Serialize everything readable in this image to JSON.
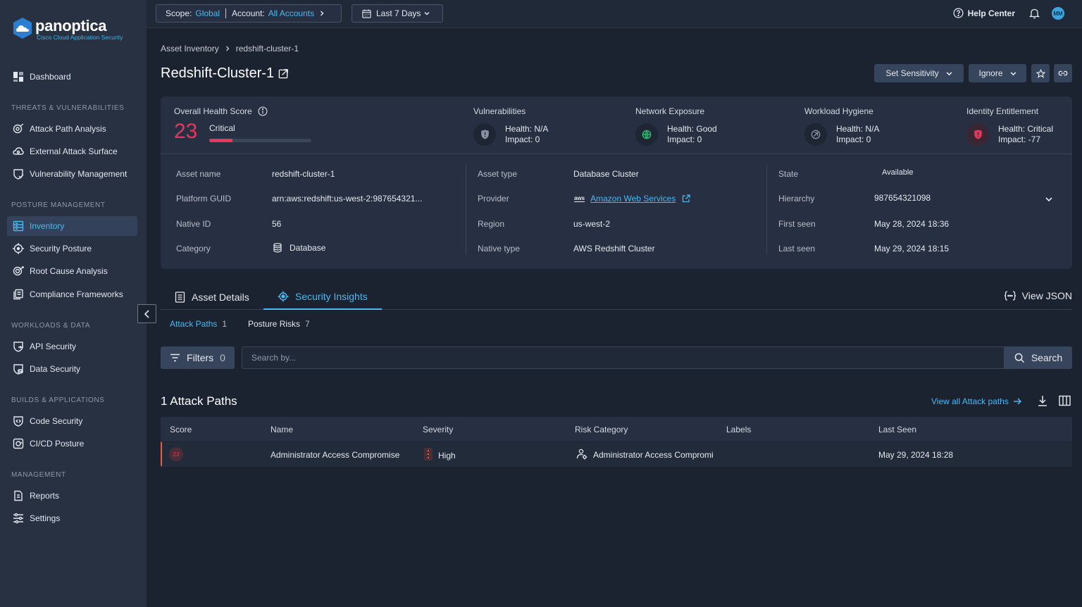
{
  "brand": {
    "name": "panoptica",
    "subtitle": "Cisco Cloud Application Security"
  },
  "colors": {
    "accent": "#4bb8ef",
    "critical": "#e6375f",
    "high": "#e8603a"
  },
  "sidebar": {
    "dashboard": "Dashboard",
    "sections": {
      "threats": "THREATS & VULNERABILITIES",
      "posture": "POSTURE MANAGEMENT",
      "workloads": "WORKLOADS & DATA",
      "builds": "BUILDS & APPLICATIONS",
      "management": "MANAGEMENT"
    },
    "items": {
      "attack_path": "Attack Path Analysis",
      "external": "External Attack Surface",
      "vuln": "Vulnerability Management",
      "inventory": "Inventory",
      "security_posture": "Security Posture",
      "root_cause": "Root Cause Analysis",
      "compliance": "Compliance Frameworks",
      "api": "API Security",
      "data": "Data Security",
      "code": "Code Security",
      "cicd": "CI/CD Posture",
      "reports": "Reports",
      "settings": "Settings"
    }
  },
  "topbar": {
    "scope_label": "Scope:",
    "scope_value": "Global",
    "account_label": "Account:",
    "account_value": "All Accounts",
    "date_range": "Last 7 Days",
    "help": "Help Center",
    "avatar": "MM"
  },
  "breadcrumb": {
    "parent": "Asset Inventory",
    "current": "redshift-cluster-1"
  },
  "page": {
    "title": "Redshift-Cluster-1"
  },
  "actions": {
    "set_sensitivity": "Set Sensitivity",
    "ignore": "Ignore"
  },
  "health": {
    "label": "Overall Health Score",
    "score": "23",
    "status": "Critical",
    "score_fraction": 0.23,
    "metrics": [
      {
        "title": "Vulnerabilities",
        "health": "Health: N/A",
        "impact": "Impact: 0"
      },
      {
        "title": "Network Exposure",
        "health": "Health: Good",
        "impact": "Impact: 0"
      },
      {
        "title": "Workload Hygiene",
        "health": "Health: N/A",
        "impact": "Impact: 0"
      },
      {
        "title": "Identity Entitlement",
        "health": "Health: Critical",
        "impact": "Impact: -77"
      }
    ]
  },
  "details": {
    "asset_name_label": "Asset name",
    "asset_name": "redshift-cluster-1",
    "guid_label": "Platform GUID",
    "guid": "arn:aws:redshift:us-west-2:987654321...",
    "native_id_label": "Native ID",
    "native_id": "56",
    "category_label": "Category",
    "category": "Database",
    "asset_type_label": "Asset type",
    "asset_type": "Database Cluster",
    "provider_label": "Provider",
    "provider": "Amazon Web Services",
    "provider_logo": "aws",
    "region_label": "Region",
    "region": "us-west-2",
    "native_type_label": "Native type",
    "native_type": "AWS Redshift Cluster",
    "state_label": "State",
    "state": "Available",
    "hierarchy_label": "Hierarchy",
    "hierarchy": "987654321098",
    "first_seen_label": "First seen",
    "first_seen": "May 28, 2024 18:36",
    "last_seen_label": "Last seen",
    "last_seen": "May 29, 2024 18:15"
  },
  "tabs": {
    "asset_details": "Asset Details",
    "security_insights": "Security Insights",
    "view_json": "View JSON"
  },
  "subtabs": {
    "attack_paths": "Attack Paths",
    "attack_paths_count": "1",
    "posture_risks": "Posture Risks",
    "posture_risks_count": "7"
  },
  "filters": {
    "label": "Filters",
    "count": "0",
    "search_placeholder": "Search by...",
    "search_button": "Search"
  },
  "attack_paths": {
    "title": "1 Attack Paths",
    "view_all": "View all Attack paths",
    "columns": [
      "Score",
      "Name",
      "Severity",
      "Risk Category",
      "Labels",
      "Last Seen"
    ],
    "rows": [
      {
        "score": "23",
        "name": "Administrator Access Compromise",
        "severity": "High",
        "risk_category": "Administrator Access Compromi",
        "labels": "",
        "last_seen": "May 29, 2024 18:28"
      }
    ]
  }
}
